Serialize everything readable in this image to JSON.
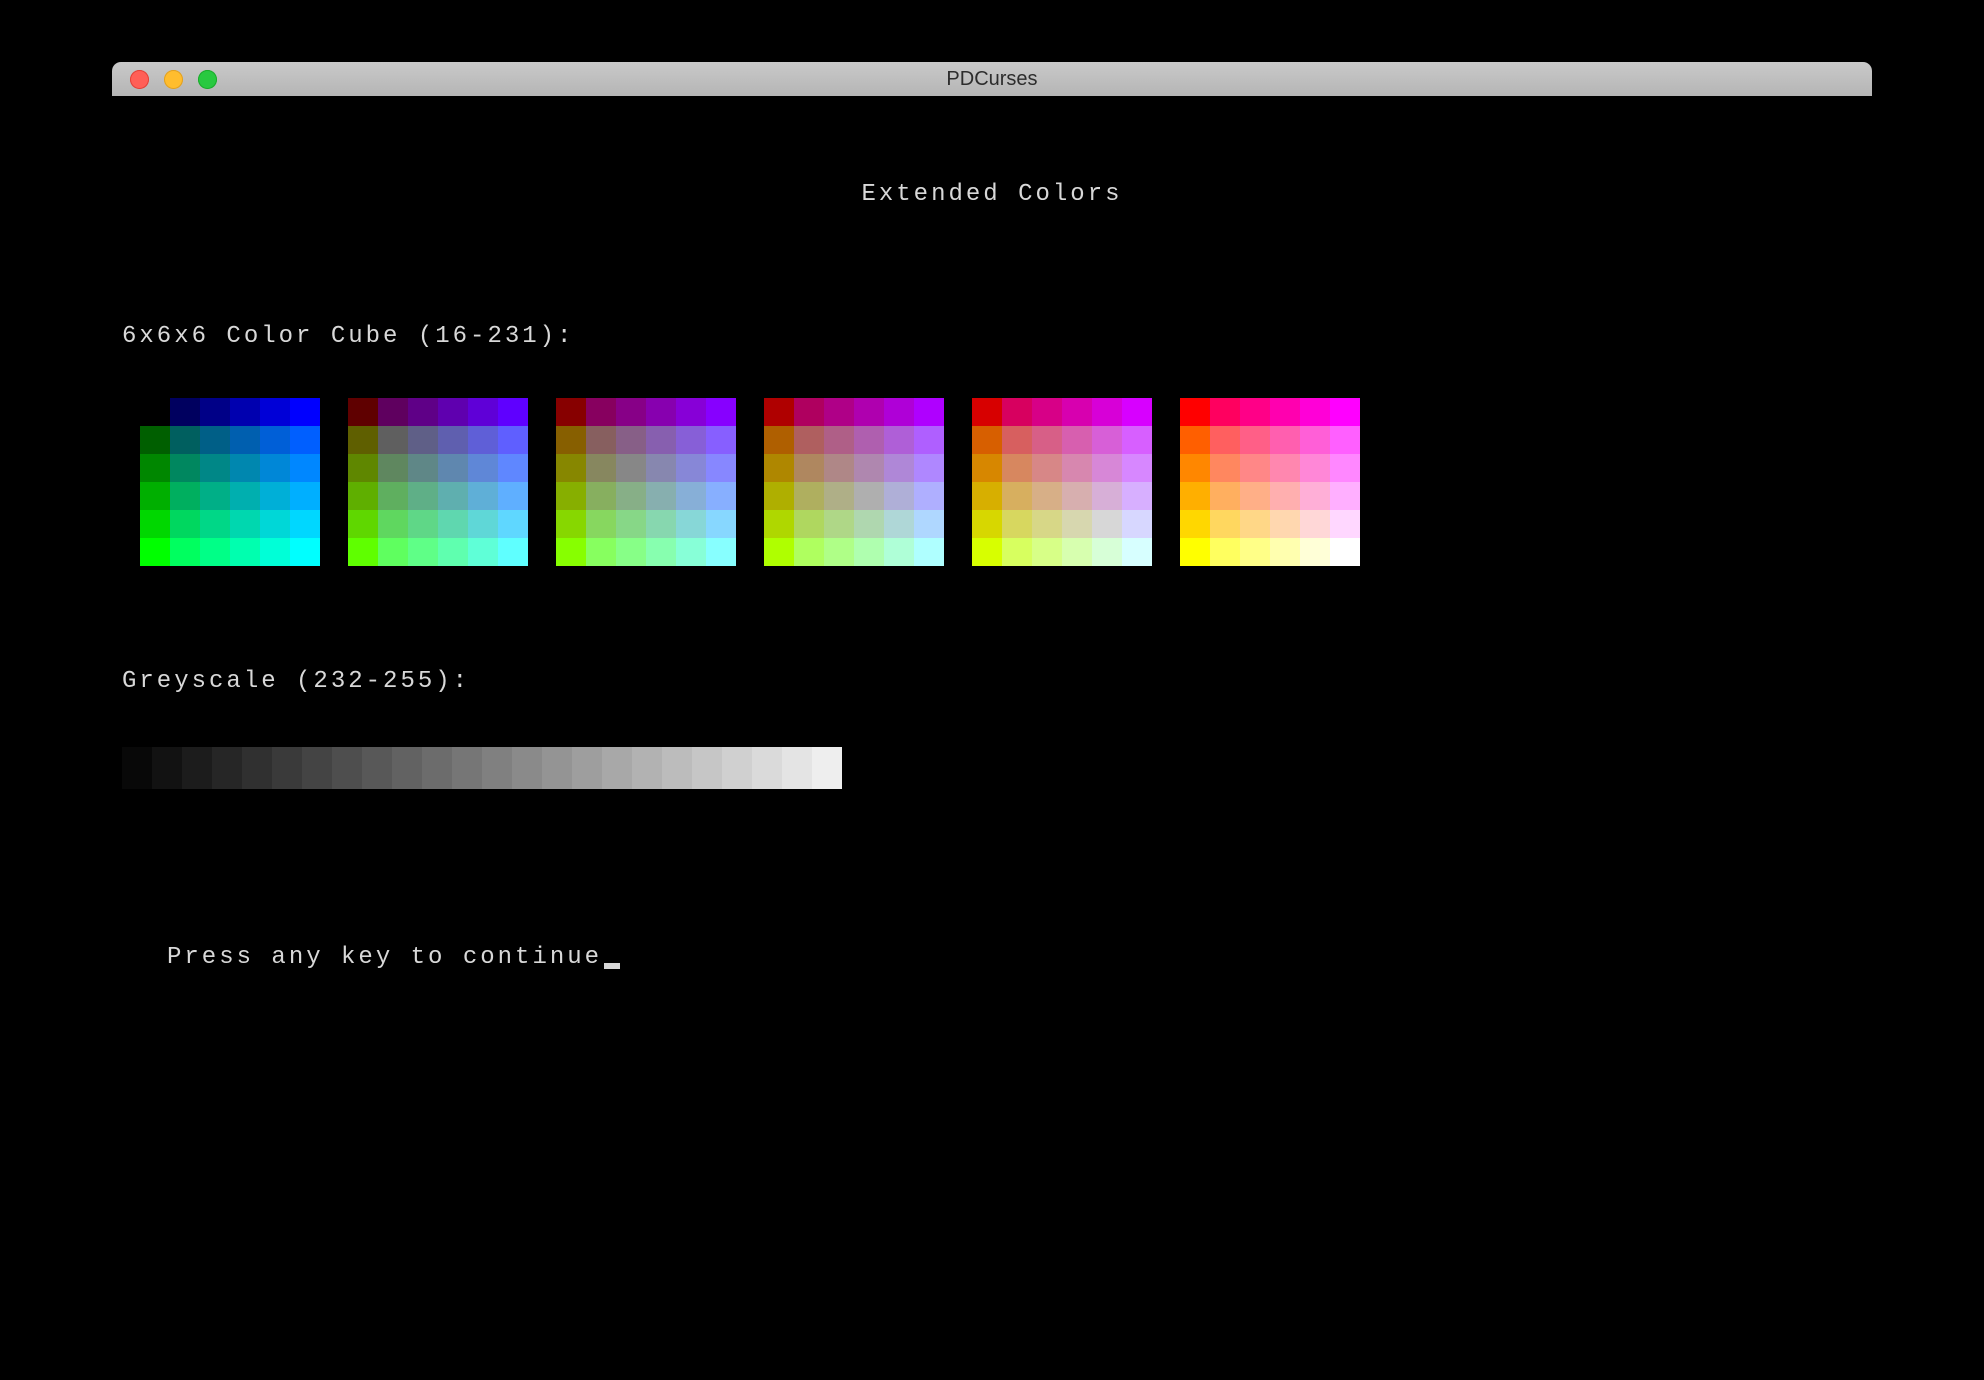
{
  "window": {
    "title": "PDCurses"
  },
  "heading": "Extended Colors",
  "cube_label": "6x6x6 Color Cube (16-231):",
  "greyscale_label": "Greyscale (232-255):",
  "prompt": "Press any key to continue",
  "color_cube": {
    "levels": [
      0,
      95,
      135,
      175,
      215,
      255
    ],
    "index_range": "16-231",
    "description": "216-color cube, 6 panels (R), each panel 6x6 (G rows, B cols)"
  },
  "greyscale": {
    "start": 8,
    "end": 238,
    "steps": 24,
    "index_range": "232-255"
  },
  "traffic_light_colors": {
    "close": "#ff5f57",
    "minimize": "#ffbd2e",
    "zoom": "#28c940"
  }
}
